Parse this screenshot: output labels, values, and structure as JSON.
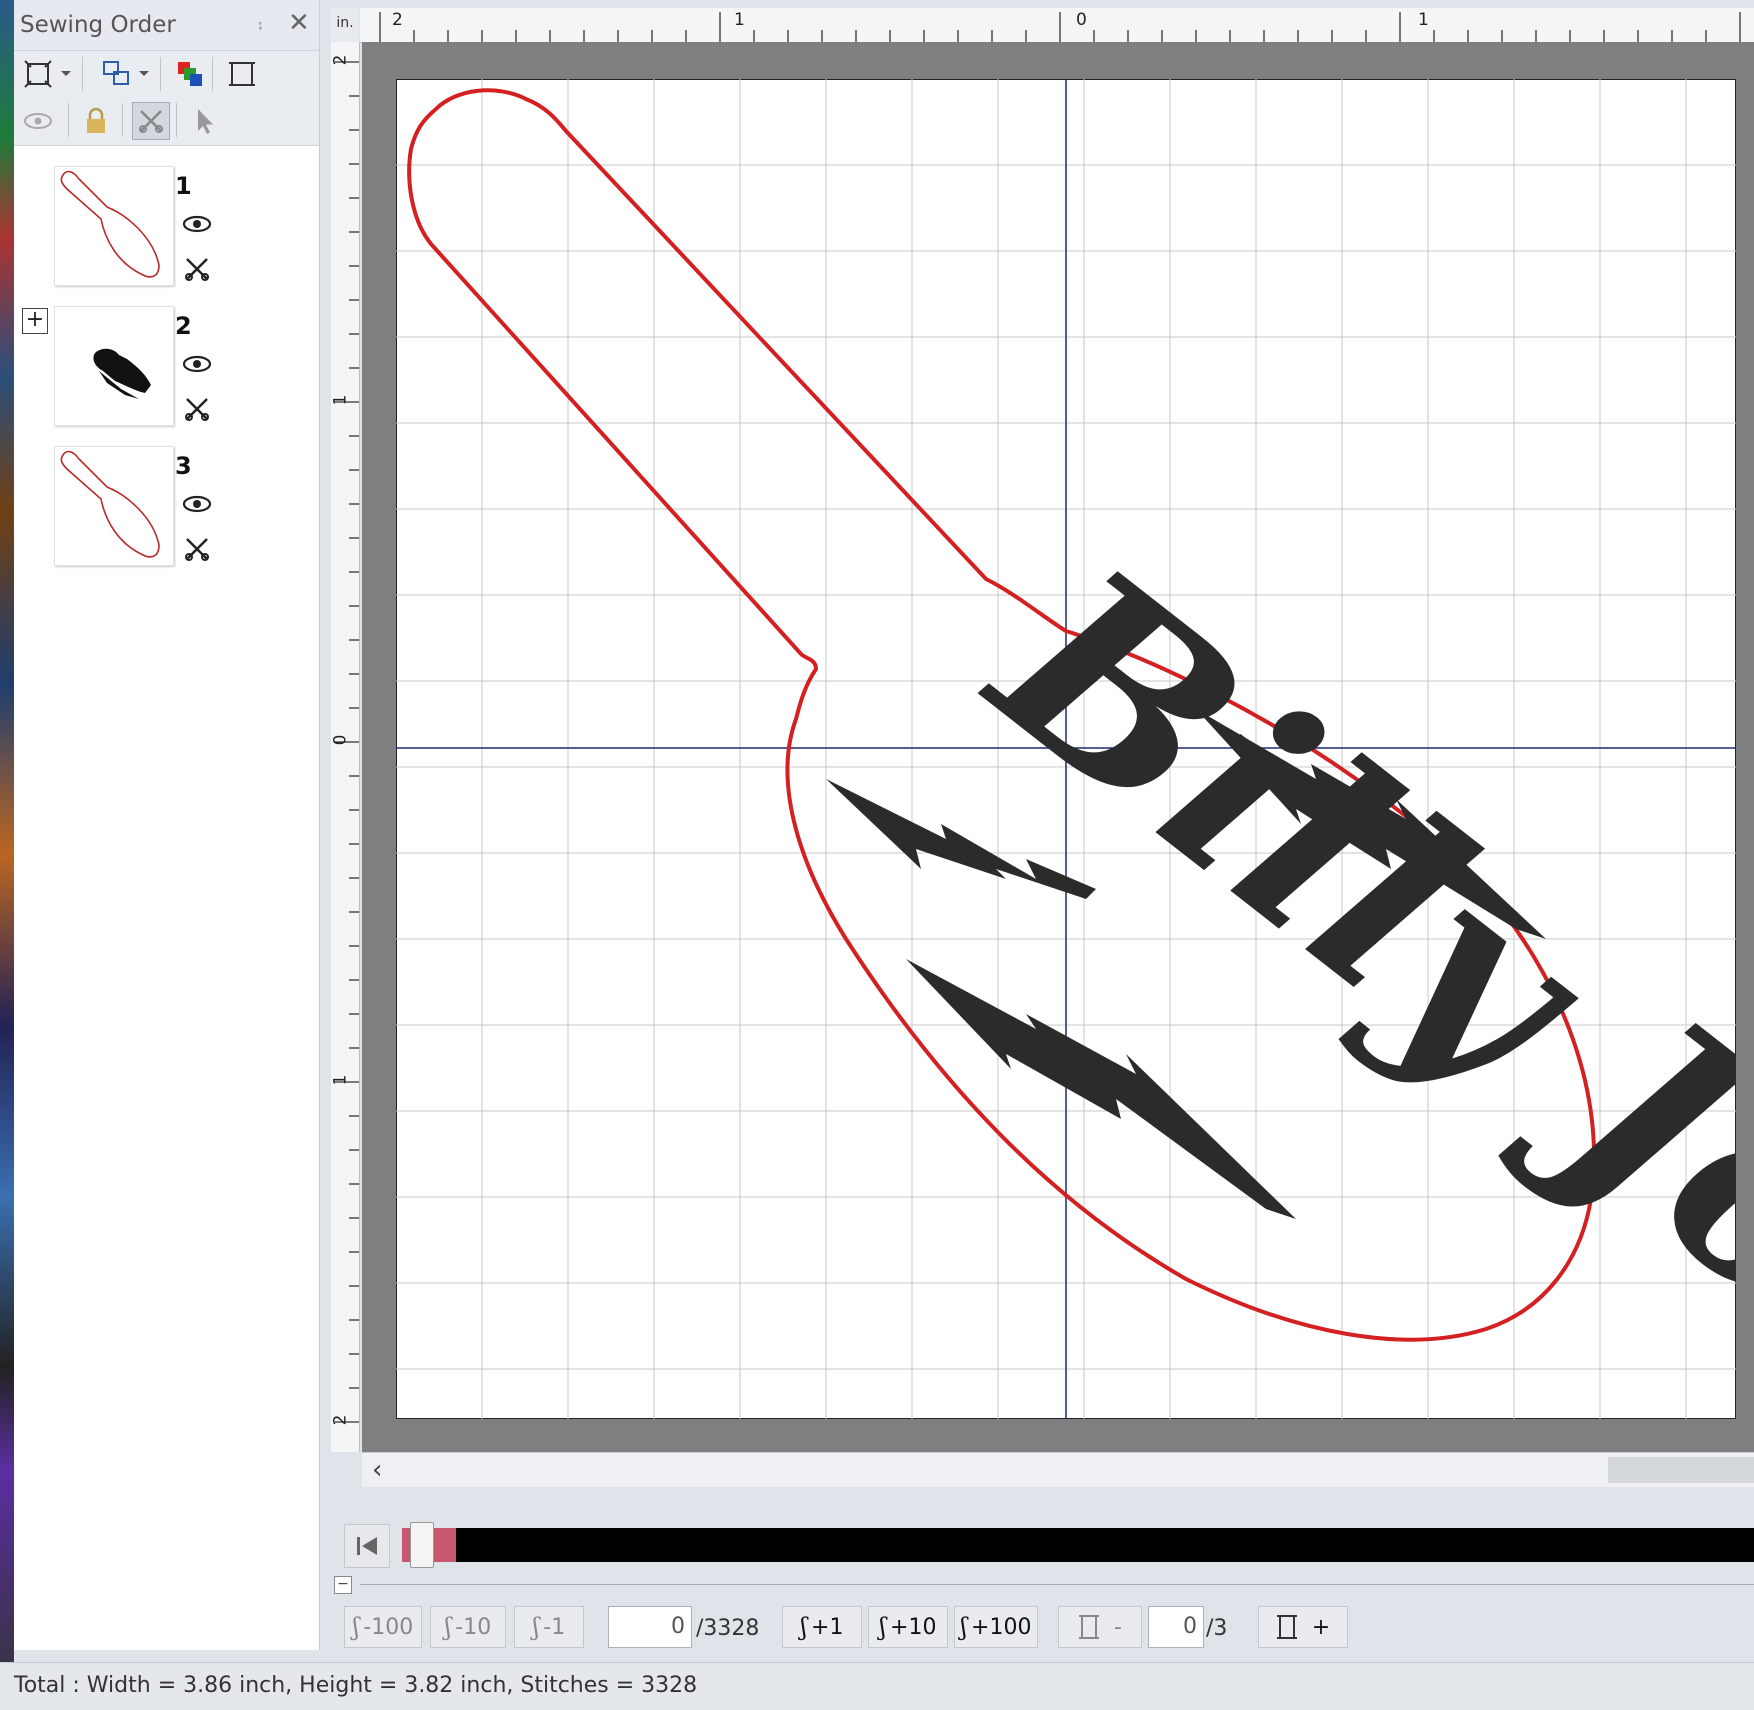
{
  "panel": {
    "title": "Sewing Order",
    "items": [
      {
        "number": "1"
      },
      {
        "number": "2"
      },
      {
        "number": "3"
      }
    ]
  },
  "ruler": {
    "unit": "in.",
    "top_labels": [
      "2",
      "1",
      "0",
      "1"
    ],
    "left_labels": [
      "2",
      "1",
      "0",
      "1",
      "2"
    ]
  },
  "design": {
    "text": "Billy Joel",
    "outline_color": "#d42020",
    "fill_color": "#2b2b2b"
  },
  "playback": {
    "progress": 0.04
  },
  "steps": {
    "minus100": "-100",
    "minus10": "-10",
    "minus1": "-1",
    "stitch_value": "0",
    "stitch_total": "/3328",
    "plus1": "+1",
    "plus10": "+10",
    "plus100": "+100",
    "color_minus": "-",
    "color_value": "0",
    "color_total": "/3",
    "color_plus": "+"
  },
  "status": {
    "text": "Total : Width = 3.86 inch, Height = 3.82 inch, Stitches = 3328"
  }
}
